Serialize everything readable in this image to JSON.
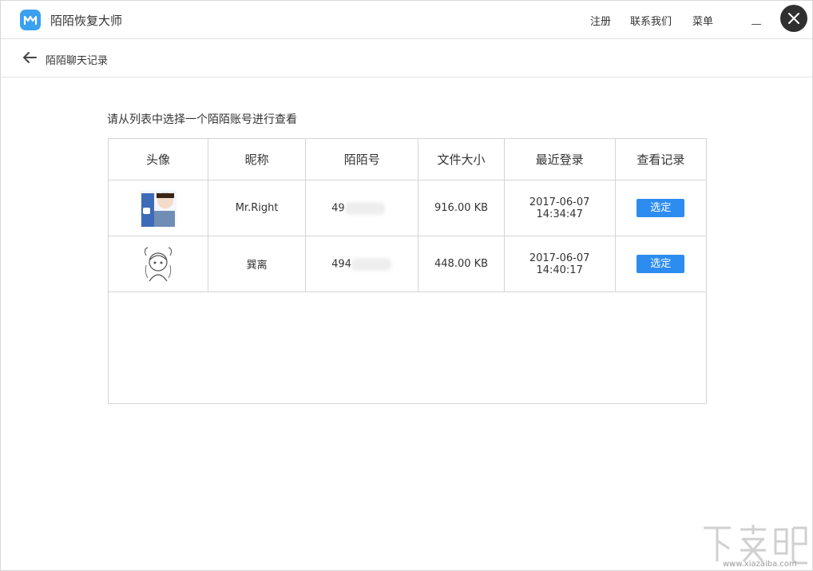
{
  "app": {
    "title": "陌陌恢复大师"
  },
  "top_menu": {
    "register": "注册",
    "contact": "联系我们",
    "menu": "菜单"
  },
  "nav": {
    "title": "陌陌聊天记录"
  },
  "instruction": "请从列表中选择一个陌陌账号进行查看",
  "table": {
    "headers": [
      "头像",
      "昵称",
      "陌陌号",
      "文件大小",
      "最近登录",
      "查看记录"
    ],
    "rows": [
      {
        "nickname": "Mr.Right",
        "momo_id": "49",
        "size": "916.00 KB",
        "last_login": "2017-06-07 14:34:47",
        "action": "选定"
      },
      {
        "nickname": "巽离",
        "momo_id": "494",
        "size": "448.00 KB",
        "last_login": "2017-06-07 14:40:17",
        "action": "选定"
      }
    ]
  },
  "watermark": {
    "text": "下载吧",
    "url": "www.xiazaiba.com"
  },
  "colors": {
    "accent": "#2d8cf0",
    "logo": "#3aa0f0",
    "close_bg": "#303030"
  },
  "icons": {
    "logo": "momo-logo-icon",
    "back": "arrow-left-icon",
    "minimize": "minimize-icon",
    "close": "close-icon"
  }
}
